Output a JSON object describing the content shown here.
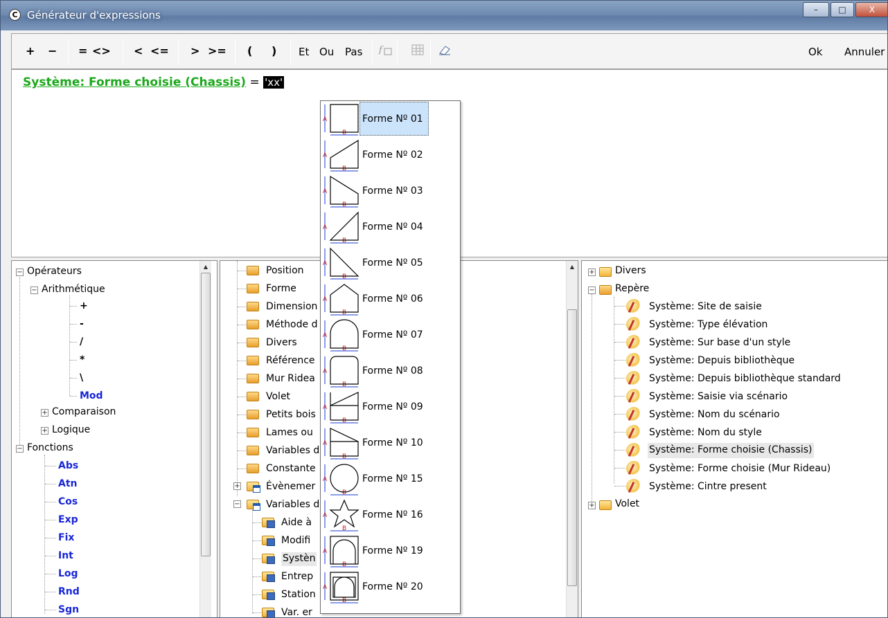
{
  "window": {
    "title": "Générateur d'expressions",
    "controls": {
      "minimize": "–",
      "maximize": "□",
      "close": "X"
    }
  },
  "toolbar": {
    "plus": "+",
    "minus": "−",
    "eq": "=",
    "neq": "<>",
    "lt": "<",
    "lte": "<=",
    "gt": ">",
    "gte": ">=",
    "lparen": "(",
    "rparen": ")",
    "and": "Et",
    "or": "Ou",
    "not": "Pas",
    "ok": "Ok",
    "cancel": "Annuler"
  },
  "expression": {
    "field": "Système: Forme choisie (Chassis)",
    "op": "=",
    "value": "'xx'"
  },
  "left_tree": {
    "operators": "Opérateurs",
    "arith": "Arithmétique",
    "arith_items": [
      "+",
      "-",
      "/",
      "*",
      "\\",
      "Mod"
    ],
    "comparison": "Comparaison",
    "logic": "Logique",
    "functions": "Fonctions",
    "function_items": [
      "Abs",
      "Atn",
      "Cos",
      "Exp",
      "Fix",
      "Int",
      "Log",
      "Rnd",
      "Sgn"
    ]
  },
  "middle_tree": {
    "items": [
      "Position",
      "Forme",
      "Dimension",
      "Méthode d",
      "Divers",
      "Référence",
      "Mur Ridea",
      "Volet",
      "Petits bois",
      "Lames ou",
      "Variables d",
      "Constante",
      "Évènemer",
      "Variables d"
    ],
    "sub_items": [
      "Aide à",
      "Modifi",
      "Systèn",
      "Entrep",
      "Station",
      "Var. er"
    ]
  },
  "dropdown": {
    "options": [
      "Forme Nº 01",
      "Forme Nº 02",
      "Forme Nº 03",
      "Forme Nº 04",
      "Forme Nº 05",
      "Forme Nº 06",
      "Forme Nº 07",
      "Forme Nº 08",
      "Forme Nº 09",
      "Forme Nº 10",
      "Forme Nº 15",
      "Forme Nº 16",
      "Forme Nº 19",
      "Forme Nº 20"
    ],
    "dim_a": "A",
    "dim_b": "B"
  },
  "right_tree": {
    "divers": "Divers",
    "repere": "Repère",
    "items": [
      "Système: Site de saisie",
      "Système: Type élévation",
      "Système: Sur base d'un style",
      "Système: Depuis bibliothèque",
      "Système: Depuis bibliothèque standard",
      "Système: Saisie via scénario",
      "Système: Nom du scénario",
      "Système: Nom du style",
      "Système: Forme choisie (Chassis)",
      "Système: Forme choisie (Mur Rideau)",
      "Système: Cintre present"
    ],
    "volet": "Volet"
  },
  "colors": {
    "field_green": "#1ca81c",
    "function_blue": "#1726d6",
    "selected_bg": "#cce4fb"
  }
}
